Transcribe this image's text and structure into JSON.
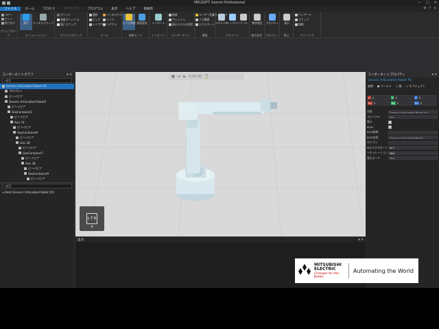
{
  "app": {
    "title": "MELSOFT Gemini Professional"
  },
  "window": {
    "minimize": "—",
    "maximize": "□",
    "close": "✕"
  },
  "menu": {
    "items": [
      "ファイル",
      "ホーム",
      "プロセス",
      "マテリアル",
      "プログラム",
      "表示",
      "ヘルプ",
      "価格改"
    ]
  },
  "ribbon": {
    "groups": [
      "クリップボード",
      "エミュレーション",
      "グリッドスナップ",
      "ツール",
      "移動モード",
      "インポート",
      "コンポーネント",
      "構築",
      "ジオメトリ",
      "動作設定",
      "プロパティ",
      "表示",
      "ウィンドウ"
    ],
    "clipboard": [
      "コピー",
      "カット",
      "貼り付け"
    ],
    "emulation_main": "実行",
    "emulation_small": [
      "インタラクティブ"
    ],
    "grid": [
      "グリッド",
      "吸着グリッド ◎",
      "面にスナップ"
    ],
    "tools": [
      "選択",
      "ピック",
      "レイアウト",
      "回転",
      "インタラクション",
      "リンク",
      "リグナル"
    ],
    "move": [
      "ビデオ移動",
      "画面変形"
    ],
    "import": [
      "インポート",
      "エクスポート"
    ],
    "component": [
      "新規",
      "キャッシュ",
      "表示モデルの形状"
    ],
    "build": [
      "ユーザー定義ウィザード",
      "パス関連",
      "エクスポート",
      "セット"
    ],
    "geometry": [
      "ジオメトリ",
      "フィーチャー",
      "ツール"
    ],
    "motion": [
      "動作設定"
    ],
    "props": [
      "ビヘイビア",
      "プロパティ"
    ],
    "display": [
      "表示"
    ],
    "window_grp": [
      "ウィザード",
      "スナップ",
      "移動",
      "ウィンドウの初期化",
      "表示"
    ]
  },
  "left": {
    "panel_title": "コンポーネントグラフ",
    "search_placeholder": "検索",
    "tree": [
      "Generic Articulated Robot #2",
      "プロパティ",
      "ビヘイビア",
      "Generic Articulated Robot2",
      "ビヘイビア",
      "GeoContainer3",
      "ビヘイビア",
      "Axis 14",
      "ビヘイビア",
      "GeoContainer9",
      "ビヘイビア",
      "Axis 28",
      "ビヘイビア",
      "GeoContainer7",
      "ビヘイビア",
      "Axis 38",
      "ビヘイビア",
      "GeoContainer9",
      "ビヘイビア",
      "Axis #10"
    ],
    "search2_placeholder": "検索",
    "root_item": "Root (Generic Articulated Robot #2)"
  },
  "viewport": {
    "time": "0:00.00",
    "view_cube": {
      "top": "T",
      "left": "L",
      "right": "R",
      "front": "F"
    }
  },
  "right": {
    "panel_title": "コンポーネントプロパティ",
    "component_name": "Generic Articulated Robot #2",
    "coord_label": "座標",
    "coord_options": [
      "ワールド",
      "親",
      "オブジェクト"
    ],
    "xyz": [
      {
        "axis": "X",
        "value": "0"
      },
      {
        "axis": "Y",
        "value": "0"
      },
      {
        "axis": "Z",
        "value": "0"
      },
      {
        "axis": "Rx",
        "value": "0"
      },
      {
        "axis": "Ry",
        "value": "0"
      },
      {
        "axis": "Rz",
        "value": "0"
      }
    ],
    "props": [
      {
        "k": "名前",
        "v": "Generic Articulated Robot #2"
      },
      {
        "k": "マテリアル",
        "v": "Null"
      },
      {
        "k": "表示",
        "v": "✓"
      },
      {
        "k": "BOM",
        "v": "✓"
      },
      {
        "k": "BOM説明",
        "v": ""
      },
      {
        "k": "BOM名称",
        "v": "Generic Articulated Robot"
      },
      {
        "k": "カテゴリ",
        "v": ""
      },
      {
        "k": "PDFエクスポート",
        "v": "終了"
      },
      {
        "k": "シミュレーション",
        "v": "静的"
      },
      {
        "k": "表示モード",
        "v": "すべ"
      }
    ]
  },
  "output": {
    "title": "出力"
  },
  "brand": {
    "company": "MITSUBISHI ELECTRIC",
    "tagline": "Changes for the Better",
    "slogan": "Automating the World"
  }
}
